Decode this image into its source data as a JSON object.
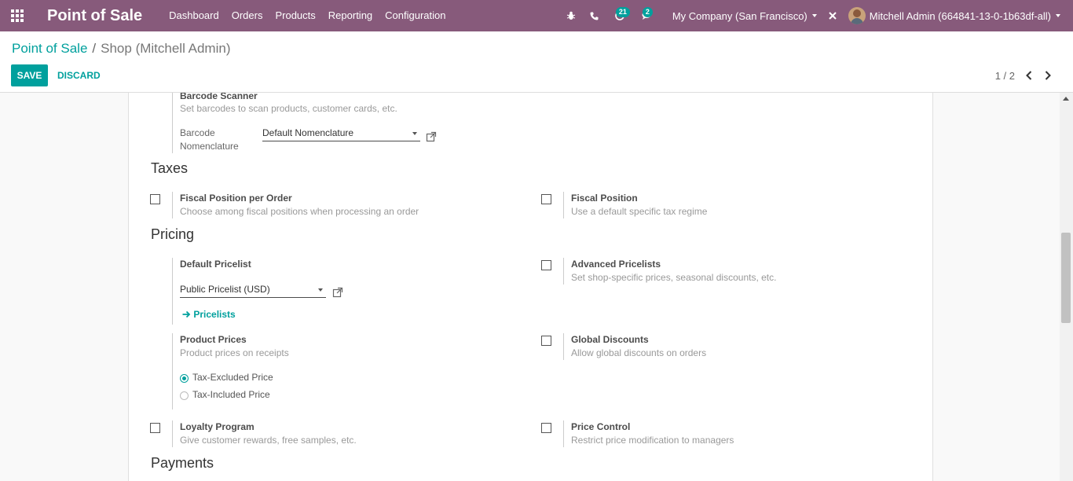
{
  "navbar": {
    "brand": "Point of Sale",
    "menu": [
      "Dashboard",
      "Orders",
      "Products",
      "Reporting",
      "Configuration"
    ],
    "activity_count": "21",
    "message_count": "2",
    "company": "My Company (San Francisco)",
    "user": "Mitchell Admin (664841-13-0-1b63df-all)"
  },
  "breadcrumb": {
    "parent": "Point of Sale",
    "separator": "/",
    "current": "Shop (Mitchell Admin)"
  },
  "actions": {
    "save": "SAVE",
    "discard": "DISCARD"
  },
  "pager": {
    "value": "1 / 2"
  },
  "barcode": {
    "title": "Barcode Scanner",
    "description": "Set barcodes to scan products, customer cards, etc.",
    "nomenclature_label_1": "Barcode",
    "nomenclature_label_2": "Nomenclature",
    "nomenclature_value": "Default Nomenclature"
  },
  "taxes": {
    "section": "Taxes",
    "fiscal_per_order_title": "Fiscal Position per Order",
    "fiscal_per_order_desc": "Choose among fiscal positions when processing an order",
    "fiscal_position_title": "Fiscal Position",
    "fiscal_position_desc": "Use a default specific tax regime"
  },
  "pricing": {
    "section": "Pricing",
    "default_pricelist_title": "Default Pricelist",
    "default_pricelist_value": "Public Pricelist (USD)",
    "pricelists_link": "Pricelists",
    "advanced_title": "Advanced Pricelists",
    "advanced_desc": "Set shop-specific prices, seasonal discounts, etc.",
    "product_prices_title": "Product Prices",
    "product_prices_desc": "Product prices on receipts",
    "radio_excluded": "Tax-Excluded Price",
    "radio_included": "Tax-Included Price",
    "global_discounts_title": "Global Discounts",
    "global_discounts_desc": "Allow global discounts on orders",
    "loyalty_title": "Loyalty Program",
    "loyalty_desc": "Give customer rewards, free samples, etc.",
    "price_control_title": "Price Control",
    "price_control_desc": "Restrict price modification to managers"
  },
  "payments": {
    "section": "Payments"
  },
  "colors": {
    "navbar": "#875a7b",
    "accent": "#00a09d"
  }
}
